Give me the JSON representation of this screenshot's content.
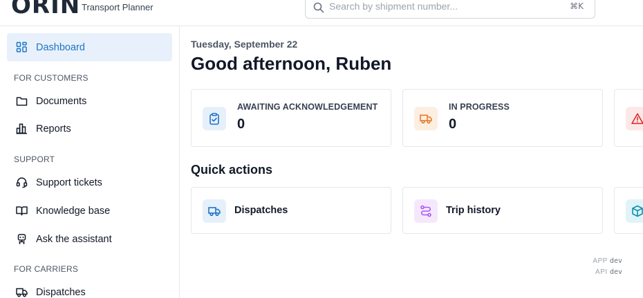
{
  "brand": {
    "logo": "ORIN",
    "subtitle": "Transport Planner"
  },
  "search": {
    "placeholder": "Search by shipment number...",
    "shortcut": "⌘K"
  },
  "sidebar": {
    "dashboard": "Dashboard",
    "sections": {
      "customers": "FOR CUSTOMERS",
      "support": "SUPPORT",
      "carriers": "FOR CARRIERS"
    },
    "items": {
      "documents": "Documents",
      "reports": "Reports",
      "support_tickets": "Support tickets",
      "knowledge_base": "Knowledge base",
      "assistant": "Ask the assistant",
      "dispatches": "Dispatches"
    }
  },
  "main": {
    "date": "Tuesday, September 22",
    "greeting": "Good afternoon, Ruben",
    "status_cards": [
      {
        "title": "AWAITING ACKNOWLEDGEMENT",
        "value": "0",
        "icon": "clipboard-check-icon",
        "color": "#1d74c7"
      },
      {
        "title": "IN PROGRESS",
        "value": "0",
        "icon": "truck-icon",
        "color": "#ea7a24"
      },
      {
        "title": "",
        "value": "",
        "icon": "warning-icon",
        "color": "#dc2626"
      }
    ],
    "quick_actions_title": "Quick actions",
    "quick_actions": [
      {
        "label": "Dispatches",
        "icon": "truck-icon",
        "color": "#1d74c7"
      },
      {
        "label": "Trip history",
        "icon": "route-icon",
        "color": "#a855f7"
      },
      {
        "label": "",
        "icon": "package-icon",
        "color": "#0891b2"
      }
    ]
  },
  "env": {
    "app_label": "APP",
    "app_value": "dev",
    "api_label": "API",
    "api_value": "dev"
  }
}
